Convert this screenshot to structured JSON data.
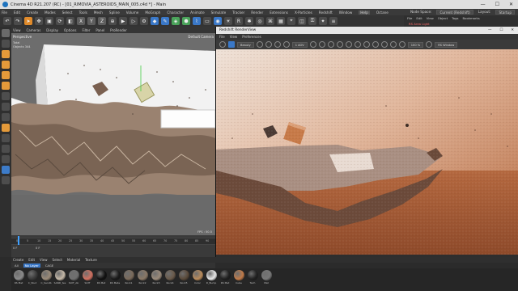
{
  "window": {
    "title": "Cinema 4D R21.207 (RC) - [01_RIMOVIA_ASTEROIDS_MAIN_005.c4d *] - Main",
    "controls": [
      "—",
      "☐",
      "✕"
    ]
  },
  "menubar": {
    "items": [
      "File",
      "Edit",
      "Create",
      "Modes",
      "Select",
      "Tools",
      "Mesh",
      "Spline",
      "Volume",
      "MoGraph",
      "Character",
      "Animate",
      "Simulate",
      "Tracker",
      "Render",
      "Extensions",
      "X-Particles",
      "Redshift",
      "Window",
      "Help",
      "Octane"
    ],
    "node_space_label": "Node Space:",
    "node_space_value": "Current (Redshift)",
    "layout_label": "Layout:",
    "layout_value": "Startup"
  },
  "toolbar": {
    "axis_x": "X",
    "axis_y": "Y",
    "axis_z": "Z"
  },
  "right_panel": {
    "menu": [
      "File",
      "Edit",
      "View",
      "Object",
      "Tags",
      "Bookmarks"
    ],
    "selected_object": "RS Area Light"
  },
  "viewport": {
    "menu": [
      "View",
      "Cameras",
      "Display",
      "Options",
      "Filter",
      "Panel",
      "ProRender"
    ],
    "label": "Perspective",
    "camera": "Default Camera",
    "stats": [
      "Total",
      "Objects  344"
    ],
    "fps": "FPS : 50.5"
  },
  "timeline": {
    "ticks": [
      "0",
      "5",
      "10",
      "15",
      "20",
      "25",
      "30",
      "35",
      "40",
      "45",
      "50",
      "55",
      "60",
      "65",
      "70",
      "75",
      "80",
      "85",
      "90"
    ],
    "frame_start": "0 F",
    "frame_current": "0 F"
  },
  "render_view": {
    "title": "Redshift RenderView",
    "controls": [
      "—",
      "☐",
      "✕"
    ],
    "menu": [
      "File",
      "View",
      "Preferences"
    ],
    "display": "Beauty",
    "aov": "1 AOV",
    "zoom": "100 %",
    "channel": "RS Window",
    "status": "Frame: 0    2021-02-04    15:49:36    (1.13s)"
  },
  "material_tabs": [
    "Create",
    "Edit",
    "View",
    "Select",
    "Material",
    "Texture"
  ],
  "material_layers": [
    "All",
    "No Layer",
    "CAGE"
  ],
  "materials": [
    {
      "label": "RS Mat",
      "color": "#8a8a8a"
    },
    {
      "label": "C_Stud",
      "color": "#3a3a3a"
    },
    {
      "label": "C_Sandb",
      "color": "#9a8a78"
    },
    {
      "label": "SAND_tes",
      "color": "#c4b7a6"
    },
    {
      "label": "SOIT_Ab",
      "color": "#6f6f6f"
    },
    {
      "label": "SOIT",
      "color": "#d07060"
    },
    {
      "label": "RS Mat",
      "color": "#111111"
    },
    {
      "label": "RS Mate",
      "color": "#1a1a1a"
    },
    {
      "label": "Rock1",
      "color": "#7a6a5a"
    },
    {
      "label": "Rock2",
      "color": "#8a7866"
    },
    {
      "label": "Rock3",
      "color": "#9a8a7a"
    },
    {
      "label": "Rock4",
      "color": "#6a5a4a"
    },
    {
      "label": "Rock5",
      "color": "#5a4a3a"
    },
    {
      "label": "Color",
      "color": "#b88a5a"
    },
    {
      "label": "D_Bump",
      "color": "#e8e8e8"
    },
    {
      "label": "RS Mat",
      "color": "#202020"
    },
    {
      "label": "Cube",
      "color": "#c07a48"
    },
    {
      "label": "Tech",
      "color": "#222222"
    },
    {
      "label": "Mat",
      "color": "#777777"
    }
  ]
}
